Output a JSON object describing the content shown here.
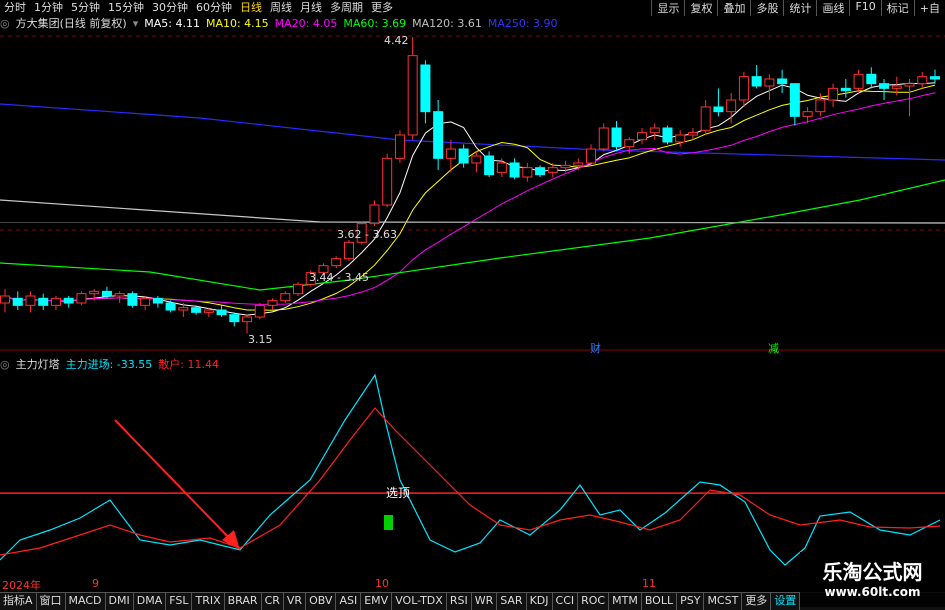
{
  "toolbar": {
    "timeframes": [
      "分时",
      "1分钟",
      "5分钟",
      "15分钟",
      "30分钟",
      "60分钟",
      "日线",
      "周线",
      "月线",
      "多周期",
      "更多"
    ],
    "active": "日线",
    "right_buttons": [
      "显示",
      "复权",
      "叠加",
      "多股",
      "统计",
      "画线",
      "F10",
      "标记",
      "+自"
    ]
  },
  "stock": {
    "title": "方大集团(日线 前复权)"
  },
  "ma_legend": [
    {
      "label": "MA5: 4.11",
      "color": "#ffffff"
    },
    {
      "label": "MA10: 4.15",
      "color": "#ffff00"
    },
    {
      "label": "MA20: 4.05",
      "color": "#ff00ff"
    },
    {
      "label": "MA60: 3.69",
      "color": "#00ff00"
    },
    {
      "label": "MA120: 3.61",
      "color": "#c0c0c0"
    },
    {
      "label": "MA250: 3.90",
      "color": "#3333ff"
    }
  ],
  "annotations": {
    "high": "4.42",
    "low": "3.15",
    "range1": "3.62 - 3.63",
    "range2": "3.44 - 3.45",
    "marker_cai": "财",
    "marker_jian": "减",
    "signal_text": "选顶"
  },
  "indicator": {
    "name": "主力灯塔",
    "line1": {
      "label": "主力进场: -33.55",
      "color": "#00e5ff"
    },
    "line2": {
      "label": "散户: 11.44",
      "color": "#ff2020"
    }
  },
  "dates": {
    "year": "2024年",
    "m9": "9",
    "m10": "10",
    "m11": "11"
  },
  "tabs": [
    "指标A",
    "窗口",
    "MACD",
    "DMI",
    "DMA",
    "FSL",
    "TRIX",
    "BRAR",
    "CR",
    "VR",
    "OBV",
    "ASI",
    "EMV",
    "VOL-TDX",
    "RSI",
    "WR",
    "SAR",
    "KDJ",
    "CCI",
    "ROC",
    "MTM",
    "BOLL",
    "PSY",
    "MCST",
    "更多",
    "设置"
  ],
  "tab_selected": "设置",
  "watermark": {
    "line1": "乐淘公式网",
    "line2": "www.60lt.com"
  },
  "chart_data": {
    "type": "candlestick",
    "price_range": [
      3.1,
      4.45
    ],
    "candles_ohlc": [
      [
        3.28,
        3.34,
        3.24,
        3.31
      ],
      [
        3.3,
        3.33,
        3.25,
        3.27
      ],
      [
        3.27,
        3.33,
        3.24,
        3.31
      ],
      [
        3.3,
        3.32,
        3.25,
        3.27
      ],
      [
        3.27,
        3.31,
        3.25,
        3.3
      ],
      [
        3.3,
        3.31,
        3.26,
        3.28
      ],
      [
        3.28,
        3.33,
        3.27,
        3.32
      ],
      [
        3.32,
        3.34,
        3.29,
        3.33
      ],
      [
        3.33,
        3.35,
        3.3,
        3.31
      ],
      [
        3.31,
        3.33,
        3.28,
        3.32
      ],
      [
        3.32,
        3.33,
        3.26,
        3.27
      ],
      [
        3.27,
        3.31,
        3.25,
        3.3
      ],
      [
        3.3,
        3.31,
        3.26,
        3.28
      ],
      [
        3.28,
        3.29,
        3.24,
        3.25
      ],
      [
        3.25,
        3.28,
        3.22,
        3.26
      ],
      [
        3.26,
        3.27,
        3.23,
        3.24
      ],
      [
        3.24,
        3.26,
        3.22,
        3.25
      ],
      [
        3.25,
        3.27,
        3.22,
        3.23
      ],
      [
        3.23,
        3.24,
        3.18,
        3.2
      ],
      [
        3.2,
        3.23,
        3.15,
        3.22
      ],
      [
        3.22,
        3.28,
        3.21,
        3.27
      ],
      [
        3.27,
        3.3,
        3.25,
        3.29
      ],
      [
        3.29,
        3.33,
        3.28,
        3.32
      ],
      [
        3.32,
        3.37,
        3.31,
        3.36
      ],
      [
        3.36,
        3.42,
        3.35,
        3.41
      ],
      [
        3.41,
        3.45,
        3.4,
        3.44
      ],
      [
        3.44,
        3.48,
        3.43,
        3.47
      ],
      [
        3.47,
        3.55,
        3.46,
        3.54
      ],
      [
        3.54,
        3.63,
        3.53,
        3.62
      ],
      [
        3.62,
        3.72,
        3.61,
        3.7
      ],
      [
        3.7,
        3.92,
        3.69,
        3.9
      ],
      [
        3.9,
        4.02,
        3.88,
        4.0
      ],
      [
        4.0,
        4.42,
        3.98,
        4.34
      ],
      [
        4.3,
        4.32,
        4.05,
        4.1
      ],
      [
        4.1,
        4.15,
        3.85,
        3.9
      ],
      [
        3.9,
        3.98,
        3.84,
        3.94
      ],
      [
        3.94,
        3.96,
        3.86,
        3.88
      ],
      [
        3.88,
        3.93,
        3.84,
        3.91
      ],
      [
        3.91,
        3.93,
        3.82,
        3.83
      ],
      [
        3.84,
        3.9,
        3.82,
        3.88
      ],
      [
        3.88,
        3.9,
        3.81,
        3.82
      ],
      [
        3.82,
        3.88,
        3.8,
        3.86
      ],
      [
        3.86,
        3.87,
        3.82,
        3.83
      ],
      [
        3.84,
        3.88,
        3.82,
        3.86
      ],
      [
        3.86,
        3.89,
        3.84,
        3.87
      ],
      [
        3.87,
        3.9,
        3.85,
        3.88
      ],
      [
        3.88,
        3.96,
        3.87,
        3.94
      ],
      [
        3.94,
        4.05,
        3.93,
        4.03
      ],
      [
        4.03,
        4.06,
        3.93,
        3.95
      ],
      [
        3.95,
        3.99,
        3.92,
        3.98
      ],
      [
        3.98,
        4.03,
        3.96,
        4.01
      ],
      [
        4.01,
        4.05,
        3.98,
        4.03
      ],
      [
        4.03,
        4.04,
        3.96,
        3.97
      ],
      [
        3.97,
        4.02,
        3.95,
        4.0
      ],
      [
        4.0,
        4.03,
        3.98,
        4.01
      ],
      [
        4.02,
        4.15,
        4.0,
        4.12
      ],
      [
        4.12,
        4.2,
        4.08,
        4.1
      ],
      [
        4.1,
        4.18,
        4.05,
        4.15
      ],
      [
        4.15,
        4.27,
        4.12,
        4.25
      ],
      [
        4.25,
        4.3,
        4.2,
        4.21
      ],
      [
        4.21,
        4.26,
        4.15,
        4.24
      ],
      [
        4.24,
        4.28,
        4.18,
        4.22
      ],
      [
        4.22,
        4.2,
        4.04,
        4.08
      ],
      [
        4.08,
        4.12,
        4.05,
        4.1
      ],
      [
        4.1,
        4.18,
        4.08,
        4.15
      ],
      [
        4.15,
        4.22,
        4.12,
        4.2
      ],
      [
        4.2,
        4.24,
        4.16,
        4.19
      ],
      [
        4.2,
        4.28,
        4.18,
        4.26
      ],
      [
        4.26,
        4.29,
        4.2,
        4.22
      ],
      [
        4.22,
        4.24,
        4.15,
        4.2
      ],
      [
        4.2,
        4.25,
        4.17,
        4.21
      ],
      [
        4.21,
        4.24,
        4.08,
        4.22
      ],
      [
        4.22,
        4.27,
        4.2,
        4.25
      ],
      [
        4.25,
        4.28,
        4.22,
        4.24
      ]
    ],
    "ma_levels": {
      "MA120_flat": 3.63,
      "range_lines": [
        3.625,
        3.445
      ]
    },
    "indicator_range": [
      -60,
      100
    ],
    "indicator_zero": 0
  }
}
